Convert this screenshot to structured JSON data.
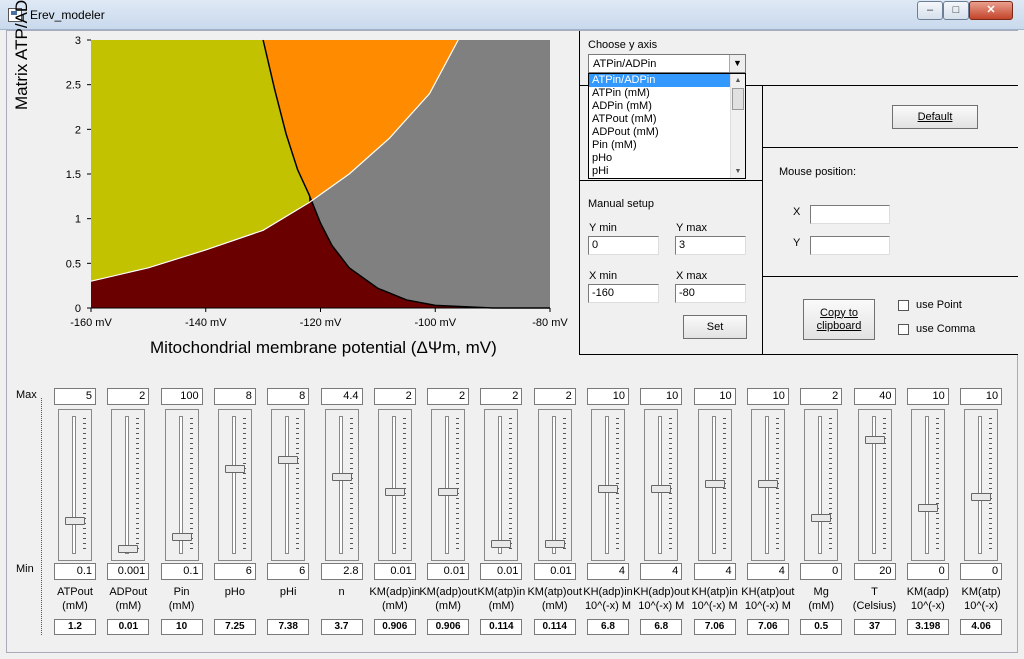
{
  "window": {
    "title": "Erev_modeler",
    "min": "–",
    "max": "□",
    "close": "✕"
  },
  "chart_data": {
    "type": "area",
    "ylabel": "Matrix ATP/ADP",
    "xlabel": "Mitochondrial membrane potential (ΔΨm, mV)",
    "xlim": [
      -160,
      -80
    ],
    "ylim": [
      0,
      3
    ],
    "x_ticks": [
      "-160 mV",
      "-140 mV",
      "-120 mV",
      "-100 mV",
      "-80 mV"
    ],
    "y_ticks": [
      "0",
      "0.5",
      "1",
      "1.5",
      "2",
      "2.5",
      "3"
    ],
    "regions": [
      {
        "color": "#c2c200",
        "position": "left-upper"
      },
      {
        "color": "#ff8c00",
        "position": "top-center"
      },
      {
        "color": "#808080",
        "position": "right"
      },
      {
        "color": "#6b0000",
        "position": "bottom"
      }
    ],
    "curves": [
      {
        "name": "black",
        "color": "#000000",
        "points": [
          [
            -130,
            3
          ],
          [
            -128,
            2.45
          ],
          [
            -126,
            1.95
          ],
          [
            -124,
            1.55
          ],
          [
            -122,
            1.27
          ],
          [
            -120,
            0.95
          ],
          [
            -118,
            0.7
          ],
          [
            -115,
            0.45
          ],
          [
            -110,
            0.22
          ],
          [
            -105,
            0.09
          ],
          [
            -100,
            0.03
          ],
          [
            -90,
            0
          ],
          [
            -80,
            0
          ]
        ]
      },
      {
        "name": "white",
        "color": "#ffffff",
        "points": [
          [
            -160,
            0.3
          ],
          [
            -150,
            0.45
          ],
          [
            -140,
            0.65
          ],
          [
            -130,
            0.87
          ],
          [
            -122,
            1.18
          ],
          [
            -115,
            1.5
          ],
          [
            -108,
            1.9
          ],
          [
            -101,
            2.4
          ],
          [
            -96,
            3
          ]
        ]
      }
    ]
  },
  "yaxis_chooser": {
    "label": "Choose y axis",
    "selected": "ATPin/ADPin",
    "options": [
      "ATPin/ADPin",
      "ATPin (mM)",
      "ADPin (mM)",
      "ATPout (mM)",
      "ADPout (mM)",
      "Pin (mM)",
      "pHo",
      "pHi"
    ]
  },
  "default_button": "Default",
  "mouse": {
    "label": "Mouse position:",
    "x_label": "X",
    "y_label": "Y",
    "x_value": "",
    "y_value": ""
  },
  "manual": {
    "label": "Manual setup",
    "ymin_label": "Y min",
    "ymax_label": "Y max",
    "xmin_label": "X min",
    "xmax_label": "X max",
    "ymin": "0",
    "ymax": "3",
    "xmin": "-160",
    "xmax": "-80",
    "set_button": "Set"
  },
  "copy": {
    "button": "Copy to clipboard",
    "use_point": "use Point",
    "use_comma": "use Comma"
  },
  "range_labels": {
    "max": "Max",
    "min": "Min"
  },
  "sliders": [
    {
      "name": "ATPout\n(mM)",
      "max": "5",
      "min": "0.1",
      "value": "1.2",
      "level": 0.22
    },
    {
      "name": "ADPout\n(mM)",
      "max": "2",
      "min": "0.001",
      "value": "0.01",
      "level": 0.01
    },
    {
      "name": "Pin\n(mM)",
      "max": "100",
      "min": "0.1",
      "value": "10",
      "level": 0.1
    },
    {
      "name": "pHo",
      "max": "8",
      "min": "6",
      "value": "7.25",
      "level": 0.62
    },
    {
      "name": "pHi",
      "max": "8",
      "min": "6",
      "value": "7.38",
      "level": 0.69
    },
    {
      "name": "n",
      "max": "4.4",
      "min": "2.8",
      "value": "3.7",
      "level": 0.56
    },
    {
      "name": "KM(adp)in\n(mM)",
      "max": "2",
      "min": "0.01",
      "value": "0.906",
      "level": 0.45
    },
    {
      "name": "KM(adp)out\n(mM)",
      "max": "2",
      "min": "0.01",
      "value": "0.906",
      "level": 0.45
    },
    {
      "name": "KM(atp)in\n(mM)",
      "max": "2",
      "min": "0.01",
      "value": "0.114",
      "level": 0.05
    },
    {
      "name": "KM(atp)out\n(mM)",
      "max": "2",
      "min": "0.01",
      "value": "0.114",
      "level": 0.05
    },
    {
      "name": "KH(adp)in\n10^(-x) M",
      "max": "10",
      "min": "4",
      "value": "6.8",
      "level": 0.47
    },
    {
      "name": "KH(adp)out\n10^(-x) M",
      "max": "10",
      "min": "4",
      "value": "6.8",
      "level": 0.47
    },
    {
      "name": "KH(atp)in\n10^(-x) M",
      "max": "10",
      "min": "4",
      "value": "7.06",
      "level": 0.51
    },
    {
      "name": "KH(atp)out\n10^(-x) M",
      "max": "10",
      "min": "4",
      "value": "7.06",
      "level": 0.51
    },
    {
      "name": "Mg\n(mM)",
      "max": "2",
      "min": "0",
      "value": "0.5",
      "level": 0.25
    },
    {
      "name": "T\n(Celsius)",
      "max": "40",
      "min": "20",
      "value": "37",
      "level": 0.85
    },
    {
      "name": "KM(adp)\n10^(-x)",
      "max": "10",
      "min": "0",
      "value": "3.198",
      "level": 0.32
    },
    {
      "name": "KM(atp)\n10^(-x)",
      "max": "10",
      "min": "0",
      "value": "4.06",
      "level": 0.41
    }
  ]
}
